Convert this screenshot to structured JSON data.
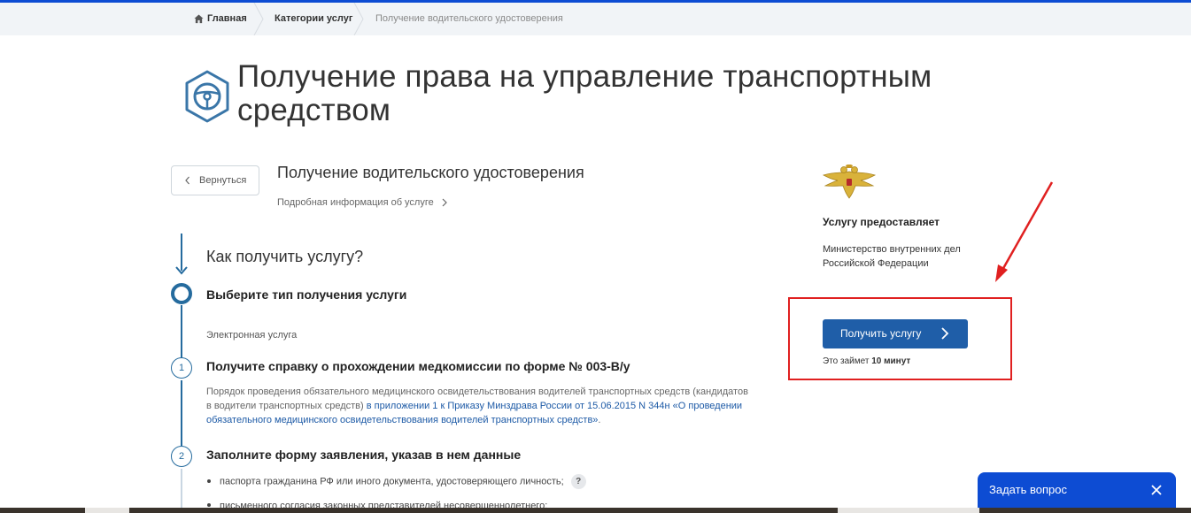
{
  "breadcrumb": {
    "home": "Главная",
    "categories": "Категории услуг",
    "current": "Получение водительского удостоверения"
  },
  "page_title": "Получение права на управление транспортным средством",
  "back_label": "Вернуться",
  "service_title": "Получение водительского удостоверения",
  "detail_link": "Подробная информация об услуге",
  "how_title": "Как получить услугу?",
  "steps": [
    {
      "title": "Выберите тип получения услуги",
      "type_label": "Электронная услуга"
    },
    {
      "number": "1",
      "title": "Получите справку о прохождении медкомиссии по форме № 003-В/у",
      "desc_plain": "Порядок проведения обязательного медицинского освидетельствования водителей транспортных средств (кандидатов в водители транспортных средств)",
      "desc_link": "в приложении 1 к Приказу Минздрава России от 15.06.2015 N 344н «О проведении обязательного медицинского освидетельствования водителей транспортных средств»",
      "desc_end": "."
    },
    {
      "number": "2",
      "title": "Заполните форму заявления, указав в нем данные",
      "bullets": [
        "паспорта гражданина РФ или иного документа, удостоверяющего личность;",
        "письменного согласия законных представителей несовершеннолетнего;"
      ]
    }
  ],
  "provider": {
    "label": "Услугу предоставляет",
    "name": "Министерство внутренних дел Российской Федерации"
  },
  "get_service": {
    "label": "Получить услугу",
    "time_prefix": "Это займет",
    "time_value": "10 минут"
  },
  "help_mark": "?",
  "ask_question": "Задать вопрос",
  "colors": {
    "accent_blue": "#0d4cd3",
    "button_blue": "#1f5ea8",
    "timeline_blue": "#256b9e",
    "annotation_red": "#e02020"
  },
  "icons": {
    "home": "home-icon",
    "logo": "steering-wheel-icon",
    "emblem": "double-headed-eagle-icon",
    "close": "close-icon"
  }
}
